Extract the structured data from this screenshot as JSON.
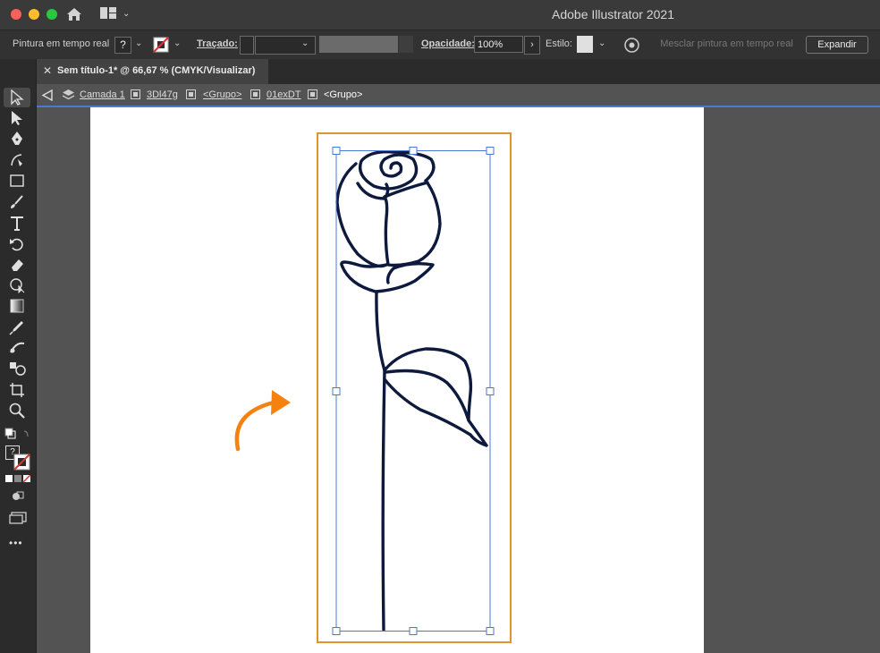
{
  "app": {
    "title": "Adobe Illustrator 2021"
  },
  "control_bar": {
    "mode_label": "Pintura em tempo real",
    "fill_label": "?",
    "stroke_label": "Traçado:",
    "opacity_label": "Opacidade:",
    "opacity_value": "100%",
    "style_label": "Estilo:",
    "merge_button": "Mesclar pintura em tempo real",
    "expand_button": "Expandir"
  },
  "tab": {
    "title": "Sem título-1* @ 66,67 % (CMYK/Visualizar)"
  },
  "breadcrumb": {
    "items": [
      "Camada 1",
      "3Dl47g",
      "<Grupo>",
      "01exDT",
      "<Grupo>"
    ]
  },
  "toolbar": {
    "tools": [
      "selection",
      "direct-selection",
      "pen",
      "curvature",
      "rectangle",
      "paintbrush",
      "type",
      "rotate",
      "eraser",
      "shape-builder",
      "gradient",
      "eyedropper",
      "blend",
      "symbol-sprayer",
      "artboard",
      "zoom"
    ],
    "more_label": "•••"
  },
  "colors": {
    "accent": "#e1942b",
    "selection_blue": "#4a79d4",
    "rose_ink": "#0d1a3d",
    "arrow": "#f5820f"
  }
}
